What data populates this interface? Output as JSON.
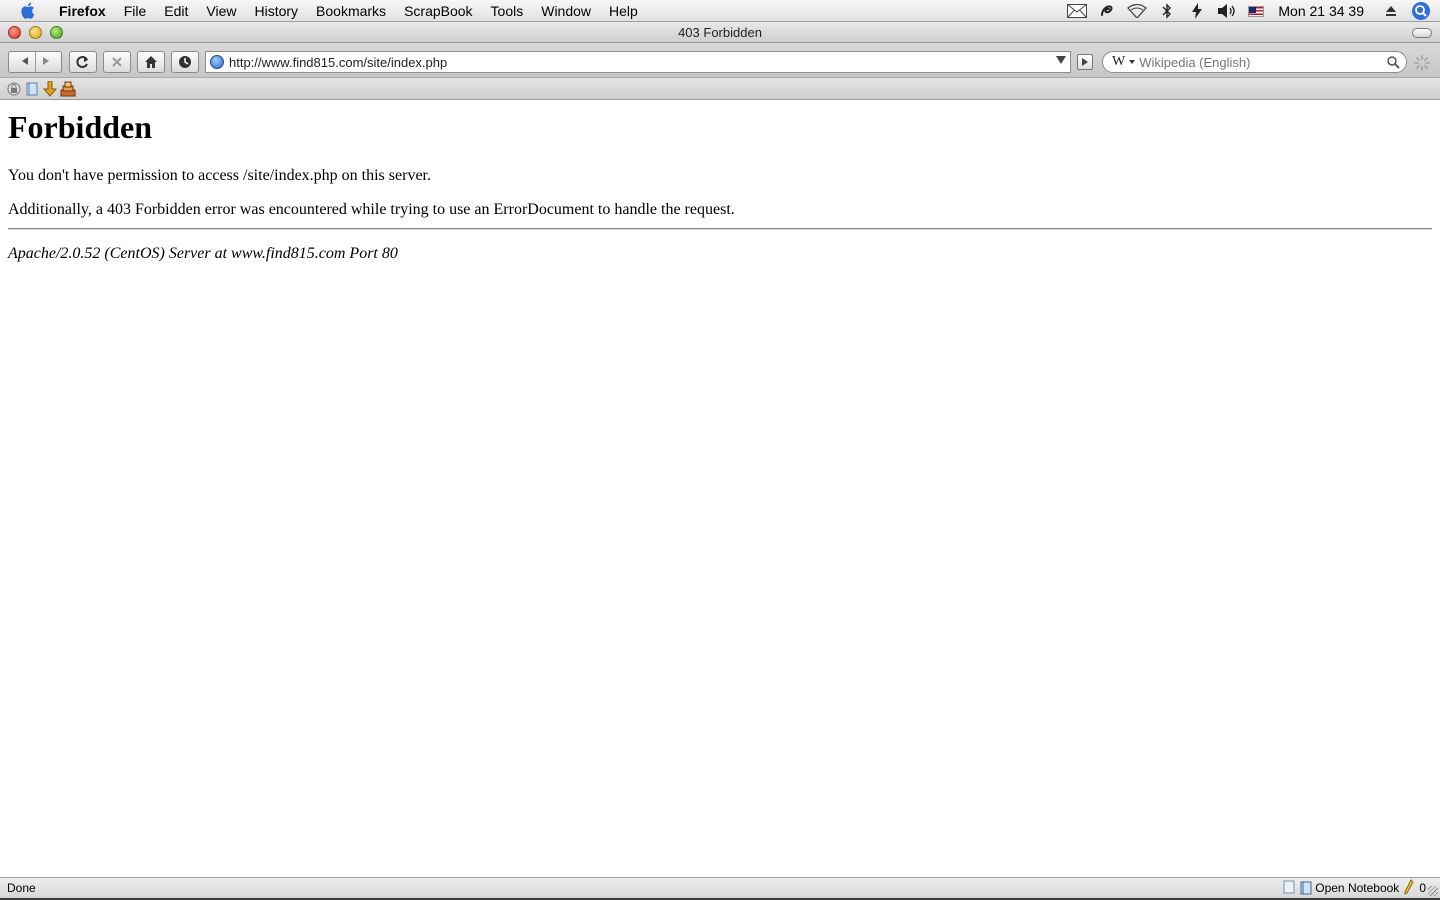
{
  "menubar": {
    "app": "Firefox",
    "items": [
      "File",
      "Edit",
      "View",
      "History",
      "Bookmarks",
      "ScrapBook",
      "Tools",
      "Window",
      "Help"
    ],
    "clock": "Mon 21 34 39"
  },
  "window": {
    "title": "403 Forbidden"
  },
  "navbar": {
    "url": "http://www.find815.com/site/index.php",
    "search_engine": "W",
    "search_placeholder": "Wikipedia (English)"
  },
  "page": {
    "heading": "Forbidden",
    "message": "You don't have permission to access /site/index.php on this server.",
    "detail": "Additionally, a 403 Forbidden error was encountered while trying to use an ErrorDocument to handle the request.",
    "server_signature": "Apache/2.0.52 (CentOS) Server at www.find815.com Port 80"
  },
  "statusbar": {
    "status": "Done",
    "notebook_label": "Open Notebook",
    "count": "0"
  }
}
